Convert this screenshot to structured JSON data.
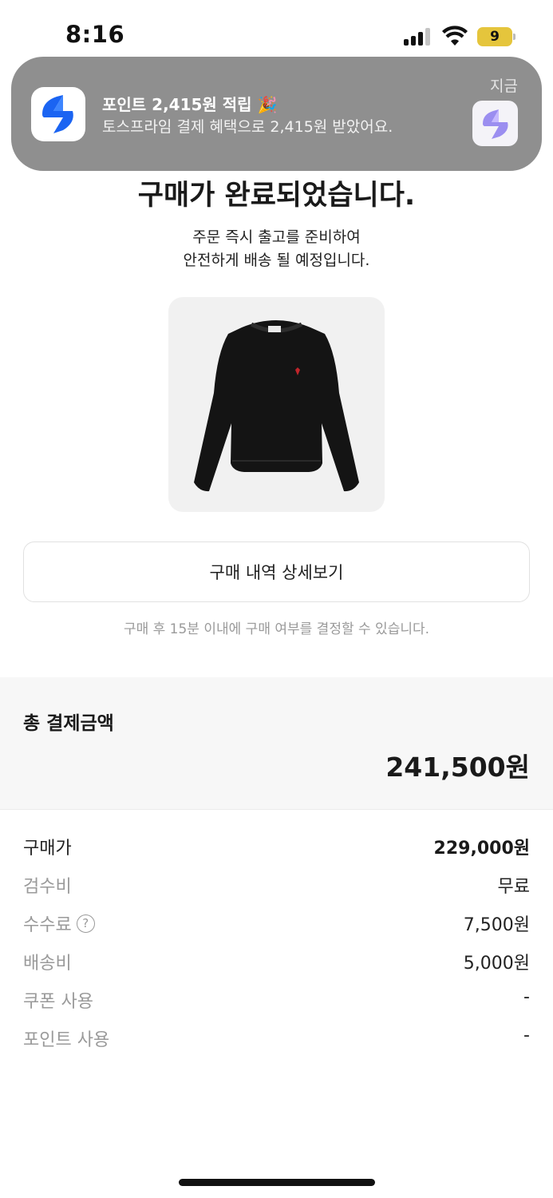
{
  "status_bar": {
    "time": "8:16",
    "battery_level": "9"
  },
  "notification": {
    "title": "포인트 2,415원 적립 🎉",
    "body": "토스프라임 결제 혜택으로 2,415원 받았어요.",
    "time": "지금",
    "app_icon": "toss-logo-icon"
  },
  "main": {
    "title": "구매가 완료되었습니다.",
    "subtitle_line1": "주문 즉시 출고를 준비하여",
    "subtitle_line2": "안전하게 배송 될 예정입니다.",
    "product_image": "black-sweatshirt-image",
    "detail_button_label": "구매 내역 상세보기",
    "notice": "구매 후 15분 이내에 구매 여부를 결정할 수 있습니다."
  },
  "total": {
    "label": "총 결제금액",
    "value": "241,500원"
  },
  "breakdown": [
    {
      "label": "구매가",
      "value": "229,000원"
    },
    {
      "label": "검수비",
      "value": "무료"
    },
    {
      "label": "수수료",
      "value": "7,500원"
    },
    {
      "label": "배송비",
      "value": "5,000원"
    },
    {
      "label": "쿠폰 사용",
      "value": "-"
    },
    {
      "label": "포인트 사용",
      "value": "-"
    }
  ],
  "colors": {
    "battery": "#e5c53c",
    "notification_bg": "#8f8f8f",
    "toss_blue": "#1b64f2",
    "muted_text": "#9a9a9a"
  }
}
